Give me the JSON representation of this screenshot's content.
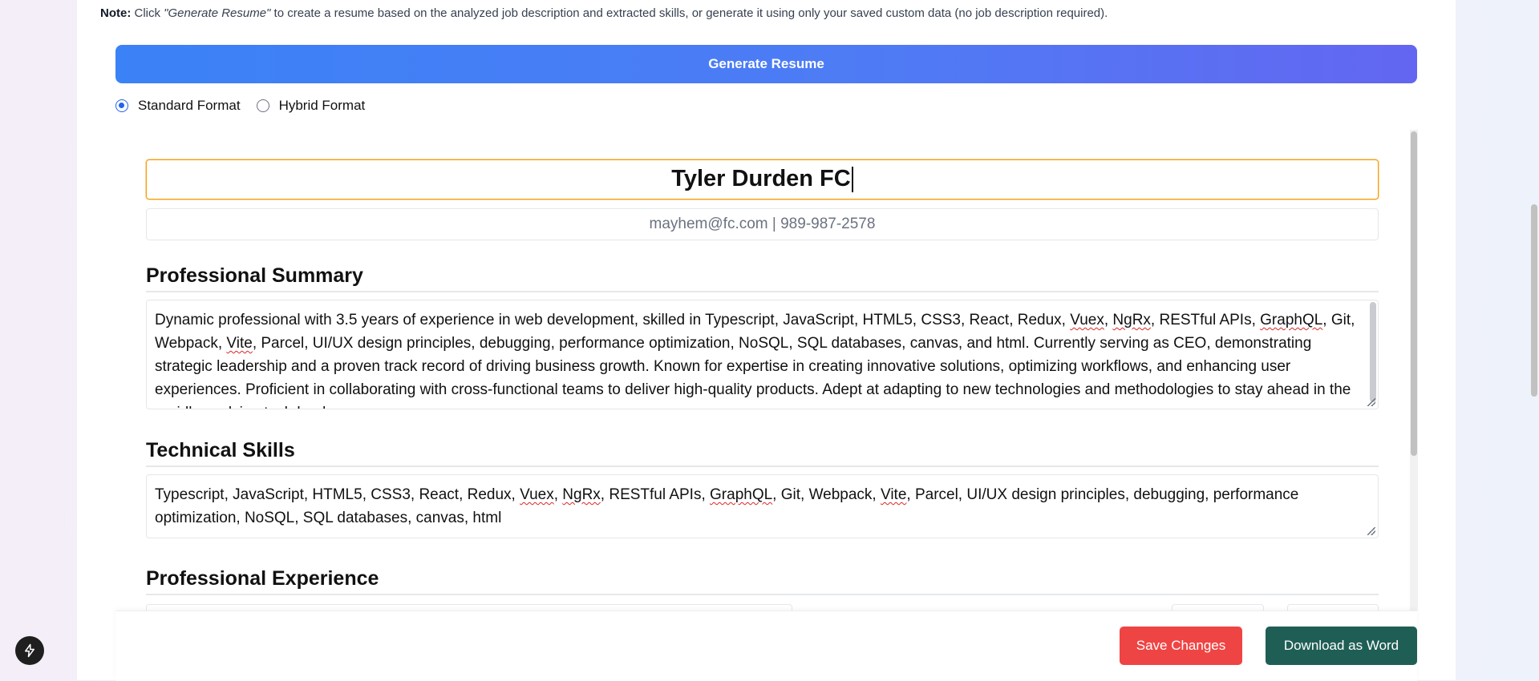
{
  "note": {
    "label": "Note:",
    "text_before": " Click ",
    "emphasis": "\"Generate Resume\"",
    "text_after": " to create a resume based on the analyzed job description and extracted skills, or generate it using only your saved custom data (no job description required)."
  },
  "generate_button": "Generate Resume",
  "format_options": [
    {
      "label": "Standard Format",
      "selected": true
    },
    {
      "label": "Hybrid Format",
      "selected": false
    }
  ],
  "resume": {
    "name": "Tyler Durden FC",
    "contact": "mayhem@fc.com | 989-987-2578",
    "summary_title": "Professional Summary",
    "summary_parts": [
      "Dynamic professional with 3.5 years of experience in web development, skilled in Typescript, JavaScript, HTML5, CSS3, React, Redux, ",
      "Vuex",
      ", ",
      "NgRx",
      ", RESTful APIs, ",
      "GraphQL",
      ", Git, Webpack, ",
      "Vite",
      ", Parcel, UI/UX design principles, debugging, performance optimization, NoSQL, SQL databases, canvas, and html. Currently serving as CEO, demonstrating strategic leadership and a proven track record of driving business growth. Known for expertise in creating innovative solutions, optimizing workflows, and enhancing user experiences. Proficient in collaborating with cross-functional teams to deliver high-quality products. Adept at adapting to new technologies and methodologies to stay ahead in the rapidly evolving tech landscape."
    ],
    "skills_title": "Technical Skills",
    "skills_parts": [
      "Typescript, JavaScript, HTML5, CSS3, React, Redux, ",
      "Vuex",
      ", ",
      "NgRx",
      ", RESTful APIs, ",
      "GraphQL",
      ", Git, Webpack, ",
      "Vite",
      ", Parcel, UI/UX design principles, debugging, performance optimization, NoSQL, SQL databases, canvas, html"
    ],
    "experience_title": "Professional Experience"
  },
  "footer": {
    "save_label": "Save Changes",
    "download_label": "Download as Word"
  },
  "colors": {
    "save": "#ef4444",
    "download": "#1f5e55",
    "generate_start": "#3b82f6",
    "generate_end": "#6366f1",
    "name_border": "#f59e0b"
  },
  "icons": {
    "bolt": "bolt-icon"
  }
}
